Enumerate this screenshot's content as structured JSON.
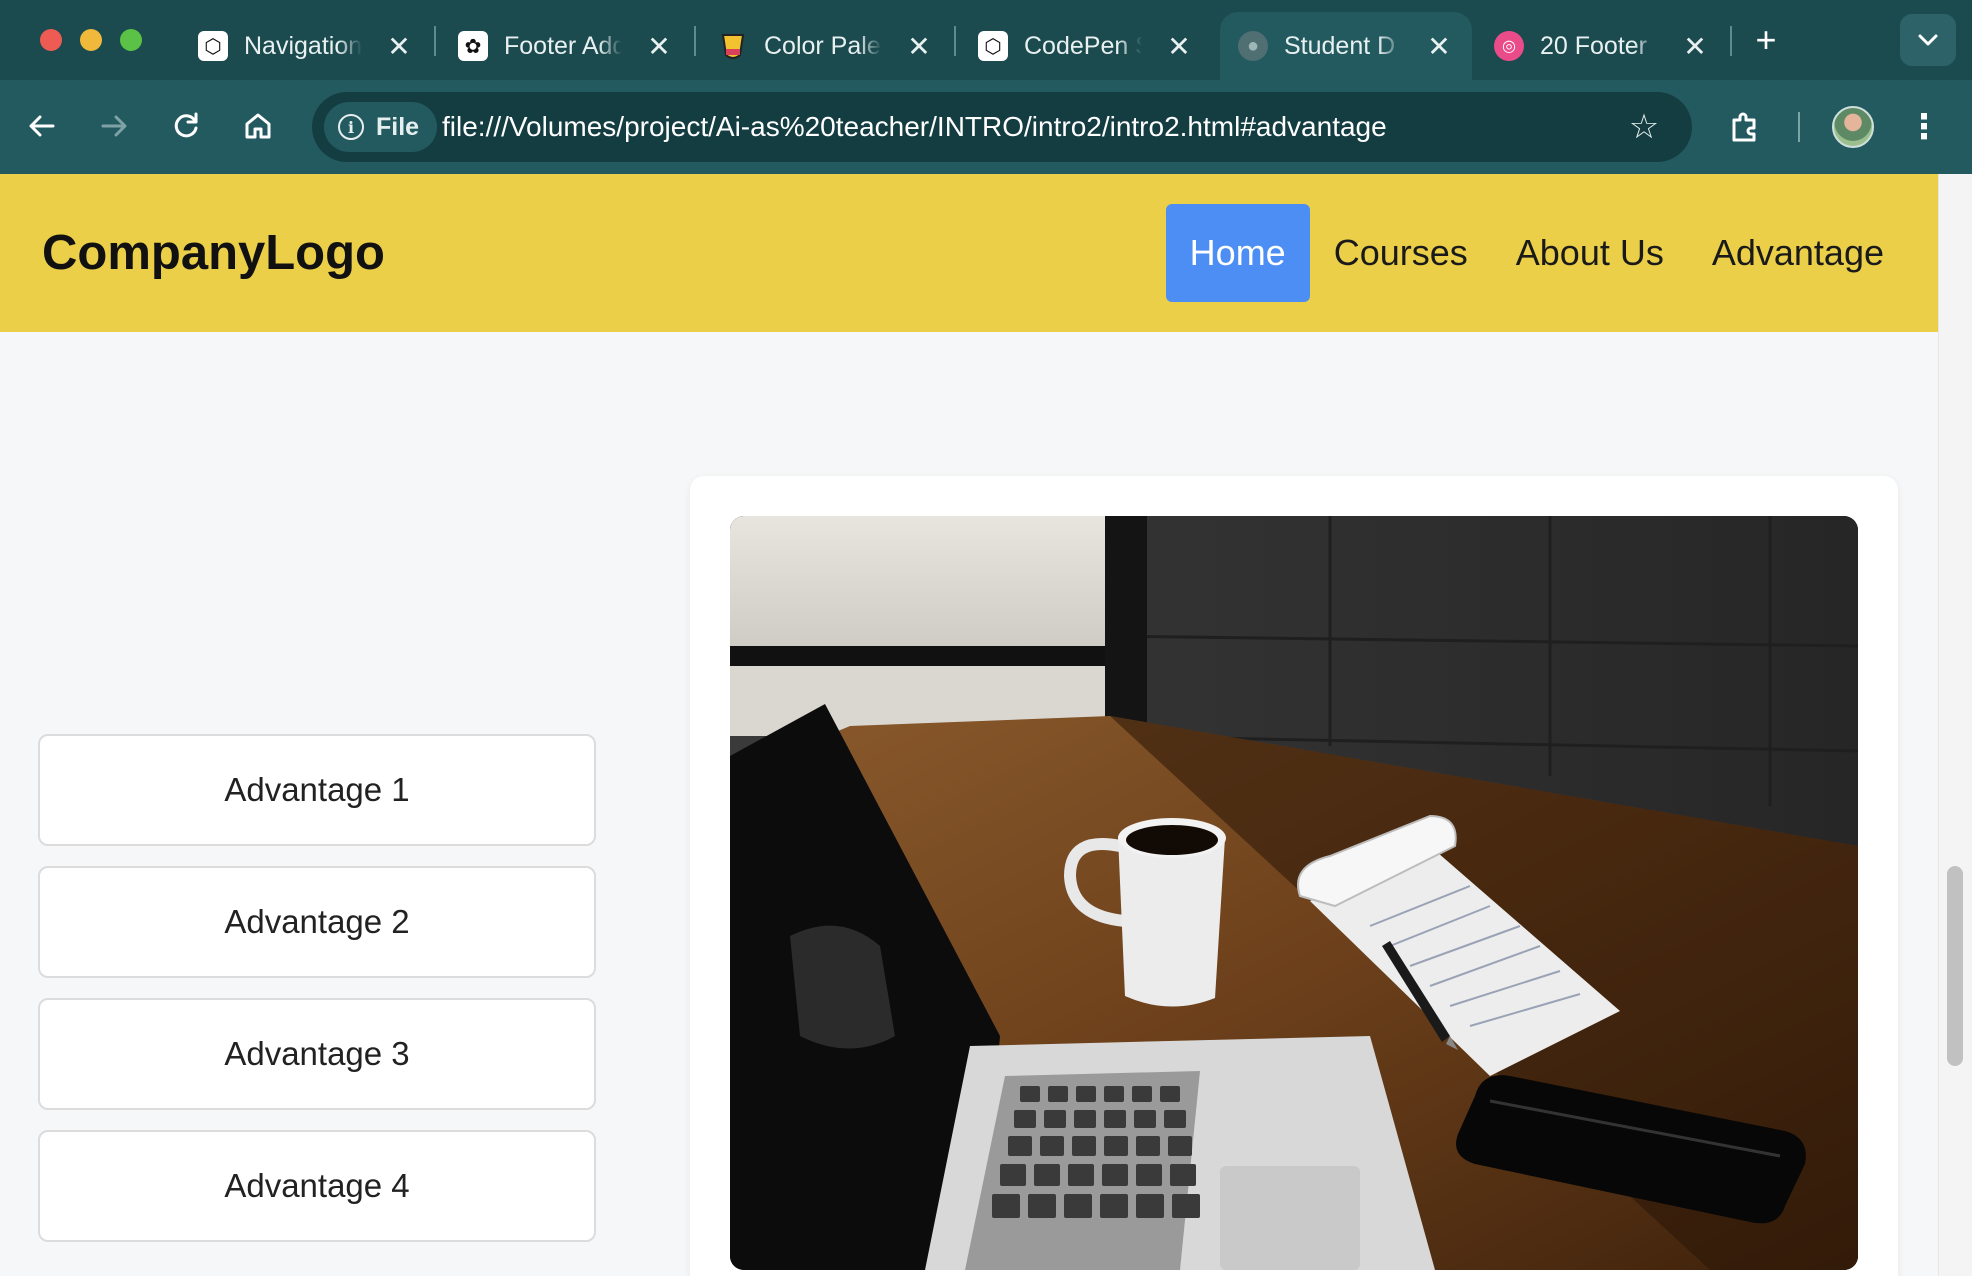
{
  "browser": {
    "tabs": [
      {
        "title": "Navigation",
        "icon": "codepen-icon",
        "active": false
      },
      {
        "title": "Footer Add",
        "icon": "openai-icon",
        "active": false
      },
      {
        "title": "Color Palet",
        "icon": "paint-bucket-icon",
        "active": false
      },
      {
        "title": "CodePen S",
        "icon": "codepen-icon",
        "active": false
      },
      {
        "title": "Student D",
        "icon": "globe-icon",
        "active": true
      },
      {
        "title": "20 Footer",
        "icon": "dribbble-icon",
        "active": false
      }
    ],
    "address": {
      "chip_label": "File",
      "url": "file:///Volumes/project/Ai-as%20teacher/INTRO/intro2/intro2.html#advantage"
    },
    "colors": {
      "tabbar": "#1b4a4f",
      "toolbar": "#235a60",
      "omnibox": "#143d42"
    }
  },
  "site": {
    "logo": "CompanyLogo",
    "nav": [
      {
        "label": "Home",
        "active": true
      },
      {
        "label": "Courses",
        "active": false
      },
      {
        "label": "About Us",
        "active": false
      },
      {
        "label": "Advantage",
        "active": false
      }
    ],
    "advantages": [
      "Advantage 1",
      "Advantage 2",
      "Advantage 3",
      "Advantage 4"
    ],
    "colors": {
      "header": "#ebcf48",
      "active_nav": "#4d8ef4",
      "page_bg": "#f6f7f8"
    }
  }
}
